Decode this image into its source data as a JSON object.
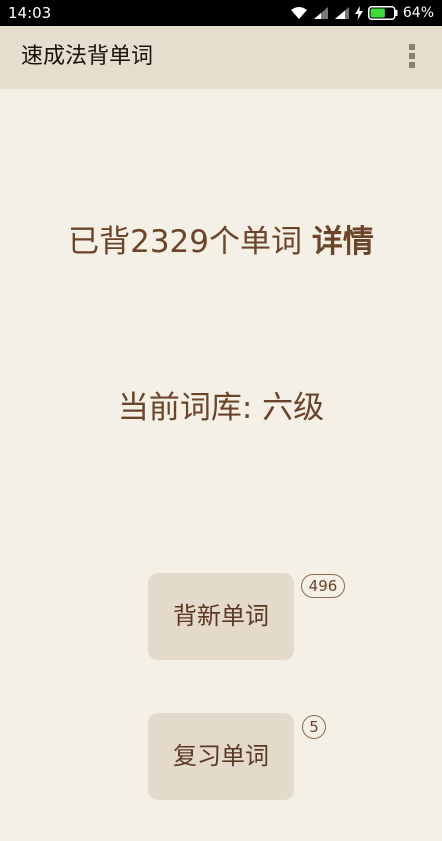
{
  "status_bar": {
    "time": "14:03",
    "battery_percent": "64%",
    "icons": [
      "wifi-icon",
      "signal-icon",
      "signal-icon",
      "charging-icon",
      "battery-icon"
    ],
    "battery_level": 0.64
  },
  "app_bar": {
    "title": "速成法背单词",
    "menu_icon": "overflow-menu-icon"
  },
  "stats": {
    "prefix": "已背2329个单词",
    "details_link": "详情"
  },
  "wordbook": {
    "label": "当前词库: 六级"
  },
  "actions": {
    "learn_new": {
      "label": "背新单词",
      "badge": "496"
    },
    "review": {
      "label": "复习单词",
      "badge": "5"
    }
  },
  "colors": {
    "background": "#f5f0e6",
    "app_bar": "#e6ddcf",
    "text_brown": "#6b4429",
    "button_bg": "#e4dacb"
  }
}
